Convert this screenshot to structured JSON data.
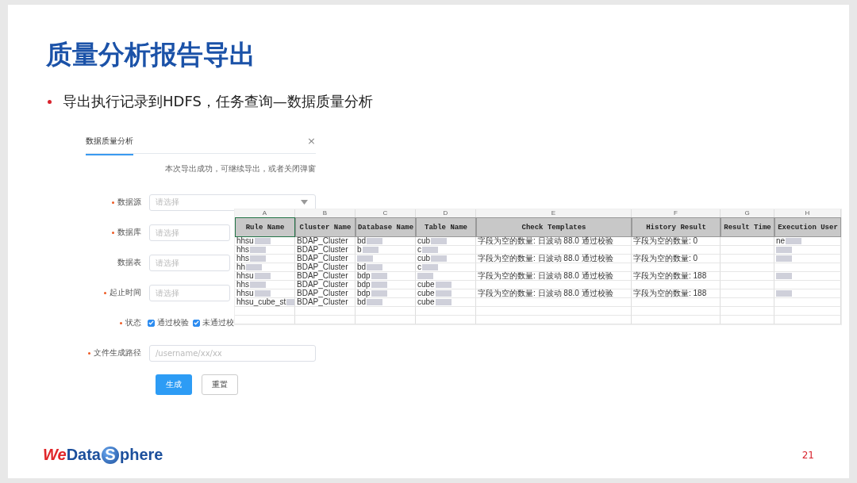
{
  "title": "质量分析报告导出",
  "bullet": "导出执行记录到HDFS，任务查询—数据质量分析",
  "dialog": {
    "tab": "数据质量分析",
    "close": "×",
    "notice": "本次导出成功，可继续导出，或者关闭弹窗",
    "fields": [
      {
        "label": "数据源",
        "required": true,
        "kind": "select",
        "placeholder": "请选择"
      },
      {
        "label": "数据库",
        "required": true,
        "kind": "input",
        "placeholder": "请选择"
      },
      {
        "label": "数据表",
        "required": false,
        "kind": "input",
        "placeholder": "请选择"
      },
      {
        "label": "起止时间",
        "required": true,
        "kind": "input",
        "placeholder": "请选择"
      },
      {
        "label": "状态",
        "required": true,
        "kind": "checks",
        "options": [
          {
            "label": "通过校验",
            "checked": true
          },
          {
            "label": "未通过校",
            "checked": true
          }
        ]
      },
      {
        "label": "文件生成路径",
        "required": true,
        "kind": "input",
        "placeholder": "/username/xx/xx"
      }
    ],
    "buttons": [
      {
        "label": "生成",
        "kind": "primary"
      },
      {
        "label": "重置",
        "kind": "default"
      }
    ]
  },
  "sheet": {
    "letters": [
      "A",
      "B",
      "C",
      "D",
      "E",
      "F",
      "G",
      "H"
    ],
    "columns": [
      "Rule Name",
      "Cluster Name",
      "Database Name",
      "Table Name",
      "Check Templates",
      "History Result",
      "Result Time",
      "Execution User"
    ],
    "rows": [
      [
        {
          "text": "hhsu",
          "masked": true
        },
        {
          "text": "BDAP_Cluster",
          "masked": false
        },
        {
          "text": "bd",
          "masked": true
        },
        {
          "text": "cub",
          "masked": true
        },
        {
          "text": "字段为空的数量: 日波动 88.0 通过校验",
          "masked": false
        },
        {
          "text": "字段为空的数量: 0",
          "masked": false
        },
        {
          "text": "",
          "masked": false
        },
        {
          "text": "ne",
          "masked": true
        }
      ],
      [
        {
          "text": "hhs",
          "masked": true
        },
        {
          "text": "BDAP_Cluster",
          "masked": false
        },
        {
          "text": "b",
          "masked": true
        },
        {
          "text": "c",
          "masked": true
        },
        {
          "text": "",
          "masked": false
        },
        {
          "text": "",
          "masked": false
        },
        {
          "text": "",
          "masked": false
        },
        {
          "text": "",
          "masked": true
        }
      ],
      [
        {
          "text": "hhs",
          "masked": true
        },
        {
          "text": "BDAP_Cluster",
          "masked": false
        },
        {
          "text": "",
          "masked": true
        },
        {
          "text": "cub",
          "masked": true
        },
        {
          "text": "字段为空的数量: 日波动 88.0 通过校验",
          "masked": false
        },
        {
          "text": "字段为空的数量: 0",
          "masked": false
        },
        {
          "text": "",
          "masked": false
        },
        {
          "text": "",
          "masked": true
        }
      ],
      [
        {
          "text": "hh",
          "masked": true
        },
        {
          "text": "BDAP_Cluster",
          "masked": false
        },
        {
          "text": "bd",
          "masked": true
        },
        {
          "text": "c",
          "masked": true
        },
        {
          "text": "",
          "masked": false
        },
        {
          "text": "",
          "masked": false
        },
        {
          "text": "",
          "masked": false
        },
        {
          "text": "",
          "masked": false
        }
      ],
      [
        {
          "text": "hhsu",
          "masked": true
        },
        {
          "text": "BDAP_Cluster",
          "masked": false
        },
        {
          "text": "bdp",
          "masked": true
        },
        {
          "text": "",
          "masked": true
        },
        {
          "text": "字段为空的数量: 日波动 88.0 通过校验",
          "masked": false
        },
        {
          "text": "字段为空的数量: 188",
          "masked": false
        },
        {
          "text": "",
          "masked": false
        },
        {
          "text": "",
          "masked": true
        }
      ],
      [
        {
          "text": "hhs",
          "masked": true
        },
        {
          "text": "BDAP_Cluster",
          "masked": false
        },
        {
          "text": "bdp",
          "masked": true
        },
        {
          "text": "cube",
          "masked": true
        },
        {
          "text": "",
          "masked": false
        },
        {
          "text": "",
          "masked": false
        },
        {
          "text": "",
          "masked": false
        },
        {
          "text": "",
          "masked": false
        }
      ],
      [
        {
          "text": "hhsu",
          "masked": true
        },
        {
          "text": "BDAP_Cluster",
          "masked": false
        },
        {
          "text": "bdp",
          "masked": true
        },
        {
          "text": "cube",
          "masked": true
        },
        {
          "text": "字段为空的数量: 日波动 88.0 通过校验",
          "masked": false
        },
        {
          "text": "字段为空的数量: 188",
          "masked": false
        },
        {
          "text": "",
          "masked": false
        },
        {
          "text": "",
          "masked": true
        }
      ],
      [
        {
          "text": "hhsu_cube_st",
          "masked": true
        },
        {
          "text": "BDAP_Cluster",
          "masked": false
        },
        {
          "text": "bd",
          "masked": true
        },
        {
          "text": "cube",
          "masked": true
        },
        {
          "text": "",
          "masked": false
        },
        {
          "text": "",
          "masked": false
        },
        {
          "text": "",
          "masked": false
        },
        {
          "text": "",
          "masked": false
        }
      ]
    ]
  },
  "logo": [
    {
      "text": "We",
      "kind": "accent"
    },
    {
      "text": "Data",
      "kind": "plain"
    },
    {
      "text": "S",
      "kind": "circle"
    },
    {
      "text": "phere",
      "kind": "plain"
    }
  ],
  "page_number": "21"
}
